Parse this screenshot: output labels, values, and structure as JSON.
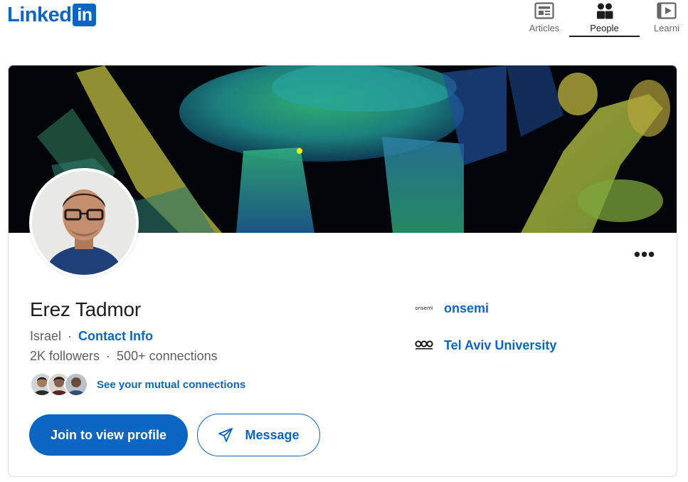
{
  "brand": {
    "logo_text": "Linked",
    "logo_in": "in"
  },
  "nav": {
    "items": [
      {
        "label": "Articles",
        "icon": "articles-icon",
        "active": false
      },
      {
        "label": "People",
        "icon": "people-icon",
        "active": true
      },
      {
        "label": "Learni",
        "icon": "learning-icon",
        "active": false
      }
    ]
  },
  "profile": {
    "name": "Erez Tadmor",
    "location": "Israel",
    "separator": "·",
    "contact_info": "Contact Info",
    "followers": "2K followers",
    "connections": "500+ connections",
    "mutual_connections": "See your mutual connections",
    "more_options": "•••"
  },
  "actions": {
    "join": "Join to view profile",
    "message": "Message"
  },
  "experience": [
    {
      "org": "onsemi",
      "logo_text": "onsemi"
    },
    {
      "org": "Tel Aviv University",
      "logo_text": ""
    }
  ],
  "colors": {
    "brand_blue": "#0a66c2",
    "text_primary": "#1d1d1d",
    "text_secondary": "#5e5e5e"
  }
}
